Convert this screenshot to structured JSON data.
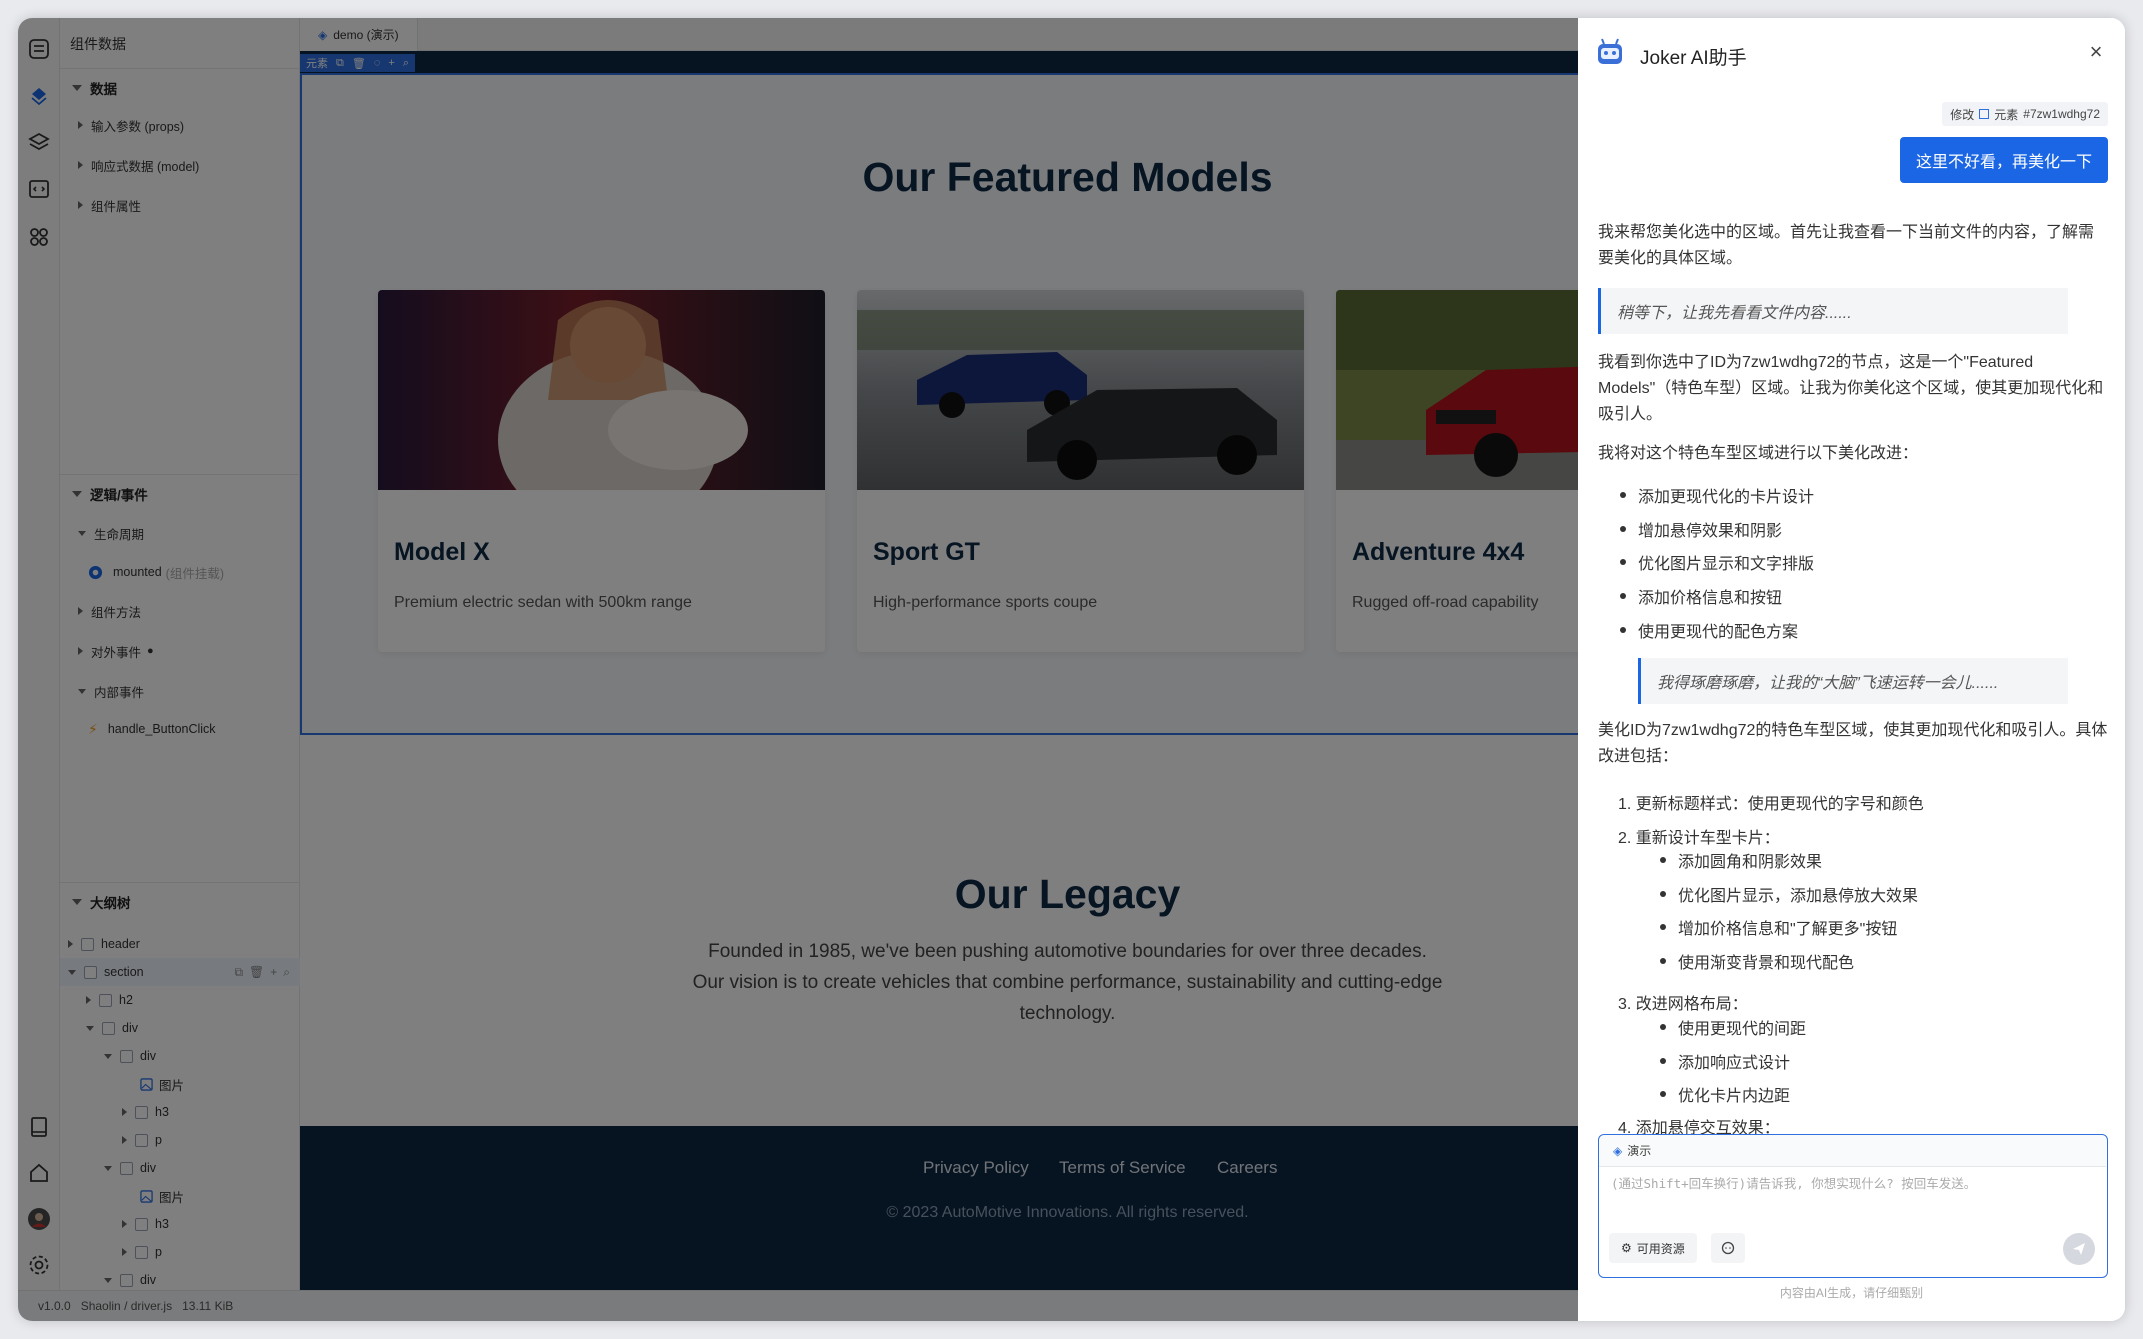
{
  "left_panel": {
    "title": "组件数据",
    "data_section": {
      "title": "数据",
      "items": [
        "输入参数 (props)",
        "响应式数据 (model)",
        "组件属性"
      ]
    },
    "logic_section": {
      "title": "逻辑/事件",
      "lifecycle_label": "生命周期",
      "mounted_label": "mounted",
      "mounted_note": "(组件挂载)",
      "methods_label": "组件方法",
      "external_events_label": "对外事件",
      "internal_events_label": "内部事件",
      "handler_label": "handle_ButtonClick"
    },
    "outline_section": {
      "title": "大纲树",
      "nodes": [
        {
          "label": "header"
        },
        {
          "label": "section"
        },
        {
          "label": "h2"
        },
        {
          "label": "div"
        },
        {
          "label": "div"
        },
        {
          "label": "图片"
        },
        {
          "label": "h3"
        },
        {
          "label": "p"
        },
        {
          "label": "div"
        },
        {
          "label": "图片"
        },
        {
          "label": "h3"
        },
        {
          "label": "p"
        },
        {
          "label": "div"
        }
      ]
    }
  },
  "status_bar": {
    "version": "v1.0.0",
    "project": "Shaolin / driver.js",
    "size": "13.11 KiB"
  },
  "canvas": {
    "tab_label": "demo (演示)",
    "selection_label": "元素",
    "featured_title": "Our Featured Models",
    "cards": [
      {
        "title": "Model X",
        "desc": "Premium electric sedan with 500km range"
      },
      {
        "title": "Sport GT",
        "desc": "High-performance sports coupe"
      },
      {
        "title": "Adventure 4x4",
        "desc": "Rugged off-road capability"
      }
    ],
    "legacy_title": "Our Legacy",
    "legacy_text": "Founded in 1985, we've been pushing automotive boundaries for over three decades. Our vision is to create vehicles that combine performance, sustainability and cutting-edge technology.",
    "footer_links": [
      "Privacy Policy",
      "Terms of Service",
      "Careers"
    ],
    "copyright": "© 2023 AutoMotive Innovations. All rights reserved."
  },
  "ai_panel": {
    "title": "Joker AI助手",
    "context_tag": {
      "action": "修改",
      "type": "元素",
      "id": "#7zw1wdhg72"
    },
    "user_message": "这里不好看，再美化一下",
    "reply_intro": "我来帮您美化选中的区域。首先让我查看一下当前文件的内容，了解需要美化的具体区域。",
    "think_1": "稍等下，让我先看看文件内容......",
    "reply_2": "我看到你选中了ID为7zw1wdhg72的节点，这是一个\"Featured Models\"（特色车型）区域。让我为你美化这个区域，使其更加现代化和吸引人。",
    "reply_3": "我将对这个特色车型区域进行以下美化改进：",
    "bullets": [
      "添加更现代化的卡片设计",
      "增加悬停效果和阴影",
      "优化图片显示和文字排版",
      "添加价格信息和按钮",
      "使用更现代的配色方案"
    ],
    "think_2": "我得琢磨琢磨，让我的“大脑”飞速运转一会儿......",
    "reply_4": "美化ID为7zw1wdhg72的特色车型区域，使其更加现代化和吸引人。具体改进包括：",
    "steps": [
      {
        "label": "1. 更新标题样式：使用更现代的字号和颜色",
        "subs": []
      },
      {
        "label": "2. 重新设计车型卡片：",
        "subs": [
          "添加圆角和阴影效果",
          "优化图片显示，添加悬停放大效果",
          "增加价格信息和\"了解更多\"按钮",
          "使用渐变背景和现代配色"
        ]
      },
      {
        "label": "3. 改进网格布局：",
        "subs": [
          "使用更现代的间距",
          "添加响应式设计",
          "优化卡片内边距"
        ]
      },
      {
        "label": "4. 添加悬停交互效果：",
        "subs": []
      }
    ],
    "input_chip": "演示",
    "input_placeholder": "(通过Shift+回车换行)请告诉我, 你想实现什么? 按回车发送。",
    "resources_button": "可用资源",
    "disclaimer": "内容由AI生成，请仔细甄别"
  },
  "colors": {
    "accent": "#1b66e5",
    "site_navy": "#0c2742",
    "heading_navy": "#0e2a47"
  }
}
